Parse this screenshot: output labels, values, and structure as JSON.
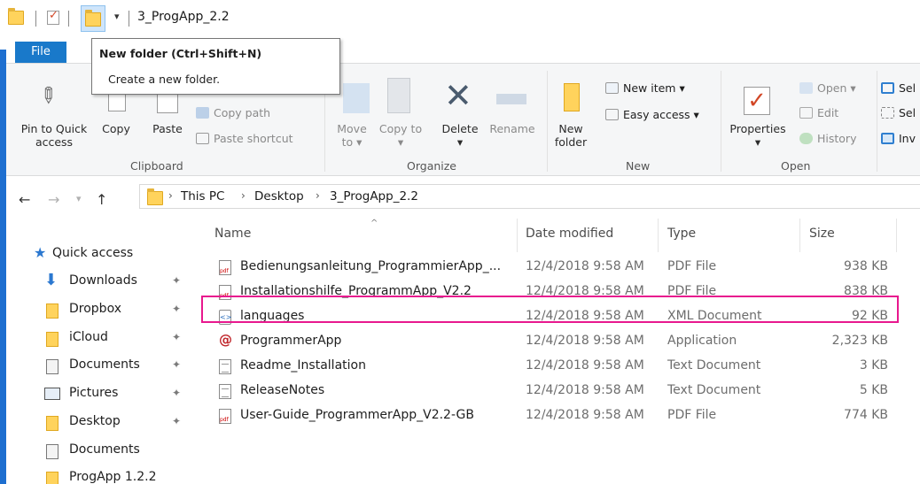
{
  "window": {
    "title": "3_ProgApp_2.2"
  },
  "tabs": {
    "file": "File"
  },
  "tooltip": {
    "title": "New folder (Ctrl+Shift+N)",
    "description": "Create a new folder."
  },
  "ribbon": {
    "clipboard": {
      "pin": "Pin to Quick access",
      "copy": "Copy",
      "paste": "Paste",
      "copy_path": "Copy path",
      "paste_shortcut": "Paste shortcut",
      "group": "Clipboard"
    },
    "organize": {
      "move_to": "Move to",
      "copy_to": "Copy to",
      "delete": "Delete",
      "rename": "Rename",
      "group": "Organize"
    },
    "new": {
      "new_folder": "New folder",
      "new_item": "New item",
      "easy_access": "Easy access",
      "group": "New"
    },
    "open": {
      "properties": "Properties",
      "open": "Open",
      "edit": "Edit",
      "history": "History",
      "group": "Open"
    },
    "select": {
      "select_all": "Sel",
      "select_none": "Sel",
      "invert": "Inv"
    }
  },
  "address": {
    "crumbs": [
      "This PC",
      "Desktop",
      "3_ProgApp_2.2"
    ]
  },
  "navpane": {
    "items": [
      {
        "label": "Quick access",
        "icon": "star-icon"
      },
      {
        "label": "Downloads",
        "icon": "download-arrow-icon",
        "pinned": true
      },
      {
        "label": "Dropbox",
        "icon": "folder-icon",
        "pinned": true
      },
      {
        "label": "iCloud",
        "icon": "folder-icon",
        "pinned": true
      },
      {
        "label": "Documents",
        "icon": "documents-icon",
        "pinned": true
      },
      {
        "label": "Pictures",
        "icon": "pictures-icon",
        "pinned": true
      },
      {
        "label": "Desktop",
        "icon": "folder-icon",
        "pinned": true
      },
      {
        "label": "Documents",
        "icon": "documents-icon"
      },
      {
        "label": "ProgApp 1.2.2",
        "icon": "folder-icon"
      }
    ]
  },
  "filelist": {
    "columns": [
      "Name",
      "Date modified",
      "Type",
      "Size"
    ],
    "rows": [
      {
        "name": "Bedienungsanleitung_ProgrammierApp_...",
        "date": "12/4/2018 9:58 AM",
        "type": "PDF File",
        "size": "938 KB",
        "icon": "pdf"
      },
      {
        "name": "Installationshilfe_ProgrammApp_V2.2",
        "date": "12/4/2018 9:58 AM",
        "type": "PDF File",
        "size": "838 KB",
        "icon": "pdf"
      },
      {
        "name": "languages",
        "date": "12/4/2018 9:58 AM",
        "type": "XML Document",
        "size": "92 KB",
        "icon": "xml"
      },
      {
        "name": "ProgrammerApp",
        "date": "12/4/2018 9:58 AM",
        "type": "Application",
        "size": "2,323 KB",
        "icon": "app"
      },
      {
        "name": "Readme_Installation",
        "date": "12/4/2018 9:58 AM",
        "type": "Text Document",
        "size": "3 KB",
        "icon": "txt"
      },
      {
        "name": "ReleaseNotes",
        "date": "12/4/2018 9:58 AM",
        "type": "Text Document",
        "size": "5 KB",
        "icon": "txt"
      },
      {
        "name": "User-Guide_ProgrammerApp_V2.2-GB",
        "date": "12/4/2018 9:58 AM",
        "type": "PDF File",
        "size": "774 KB",
        "icon": "pdf"
      }
    ]
  },
  "colors": {
    "accent": "#1979ca",
    "highlight": "#e8188e",
    "folder": "#ffd35c"
  }
}
